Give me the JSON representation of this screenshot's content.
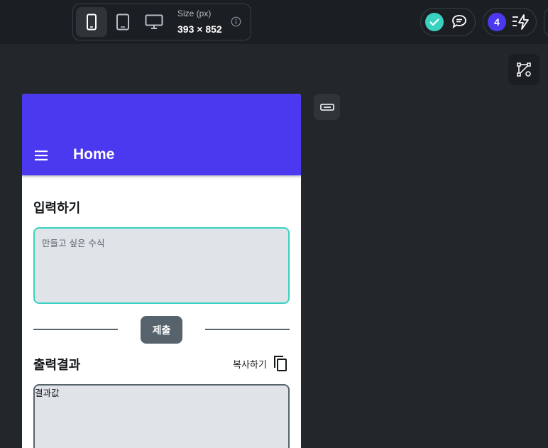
{
  "toolbar": {
    "devices": [
      {
        "name": "phone",
        "active": true
      },
      {
        "name": "tablet",
        "active": false
      },
      {
        "name": "desktop",
        "active": false
      }
    ],
    "size_label": "Size (px)",
    "size_value": "393 × 852",
    "notification_count": "4"
  },
  "app": {
    "title": "Home",
    "input_section_title": "입력하기",
    "input_placeholder": "만들고 싶은 수식",
    "submit_label": "제출",
    "output_section_title": "출력결과",
    "copy_label": "복사하기",
    "output_value": "결과값"
  },
  "colors": {
    "primary": "#4b39ef",
    "secondary": "#39d2c0",
    "input_fill": "#e0e3e7",
    "button_gray": "#57636c",
    "editor_background": "#23272b"
  }
}
